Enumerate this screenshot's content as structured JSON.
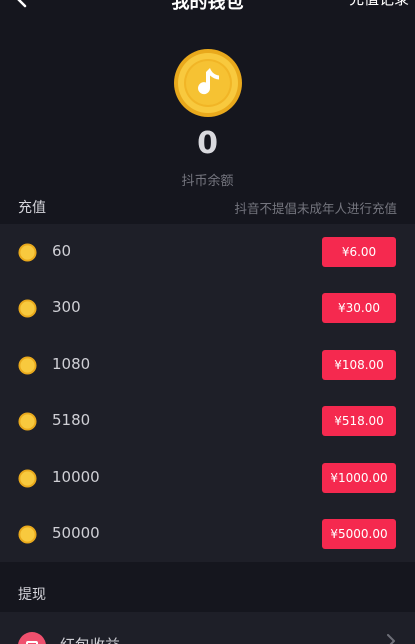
{
  "header": {
    "title": "我的钱包",
    "right_link": "充值记录",
    "back_icon": "back-arrow-icon"
  },
  "balance": {
    "value": "0",
    "label": "抖币余额",
    "coin_icon": "tiktok-coin-icon",
    "coin_color": "#f6c53a"
  },
  "recharge": {
    "title": "充值",
    "note": "抖音不提倡未成年人进行充值",
    "accent_color": "#f5294f",
    "items": [
      {
        "amount": "60",
        "price": "¥6.00"
      },
      {
        "amount": "300",
        "price": "¥30.00"
      },
      {
        "amount": "1080",
        "price": "¥108.00"
      },
      {
        "amount": "5180",
        "price": "¥518.00"
      },
      {
        "amount": "10000",
        "price": "¥1000.00"
      },
      {
        "amount": "50000",
        "price": "¥5000.00"
      }
    ]
  },
  "withdraw": {
    "title": "提现",
    "item_label": "红包收益",
    "item_icon": "red-packet-icon",
    "chevron_icon": "chevron-right-icon"
  }
}
